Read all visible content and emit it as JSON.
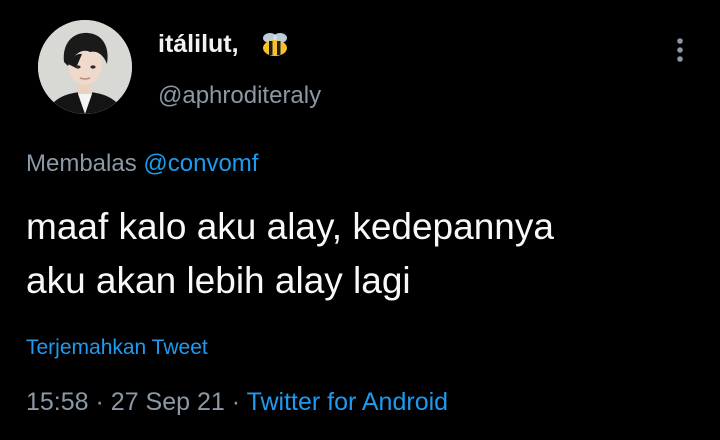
{
  "colors": {
    "background": "#000000",
    "text_primary": "#f7f9f9",
    "text_secondary": "#8b98a5",
    "link": "#1d9bf0"
  },
  "author": {
    "display_name": "itálilut,",
    "handle": "@aphroditeraly",
    "name_badge_icon": "bee-emoji-icon",
    "avatar_icon": "avatar"
  },
  "menu": {
    "icon": "more-vertical-icon"
  },
  "reply": {
    "prefix": "Membalas",
    "mention": "@convomf"
  },
  "tweet": {
    "line1": "maaf kalo aku alay, kedepannya",
    "line2": "aku akan lebih alay lagi"
  },
  "translate_label": "Terjemahkan Tweet",
  "meta": {
    "time": "15:58",
    "separator": "·",
    "date": "27 Sep 21",
    "source": "Twitter for Android"
  }
}
